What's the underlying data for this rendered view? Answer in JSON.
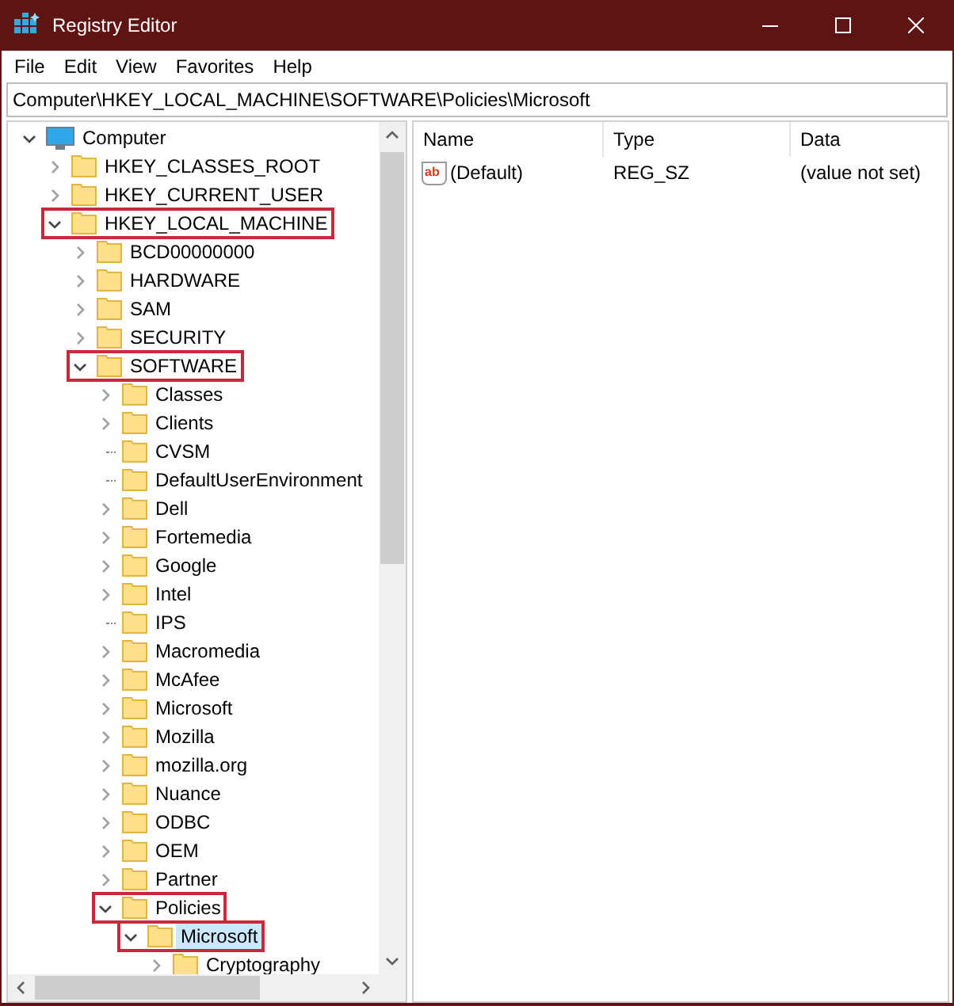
{
  "window": {
    "title": "Registry Editor"
  },
  "menu": [
    "File",
    "Edit",
    "View",
    "Favorites",
    "Help"
  ],
  "address": {
    "value": "Computer\\HKEY_LOCAL_MACHINE\\SOFTWARE\\Policies\\Microsoft"
  },
  "tree": [
    {
      "label": "Computer",
      "kind": "computer",
      "expanded": true,
      "selected": false,
      "highlighted": false,
      "children": [
        {
          "label": "HKEY_CLASSES_ROOT",
          "kind": "branch",
          "expanded": false,
          "selected": false,
          "highlighted": false
        },
        {
          "label": "HKEY_CURRENT_USER",
          "kind": "branch",
          "expanded": false,
          "selected": false,
          "highlighted": false
        },
        {
          "label": "HKEY_LOCAL_MACHINE",
          "kind": "branch",
          "expanded": true,
          "selected": false,
          "highlighted": true,
          "children": [
            {
              "label": "BCD00000000",
              "kind": "branch",
              "expanded": false,
              "selected": false,
              "highlighted": false
            },
            {
              "label": "HARDWARE",
              "kind": "branch",
              "expanded": false,
              "selected": false,
              "highlighted": false
            },
            {
              "label": "SAM",
              "kind": "branch",
              "expanded": false,
              "selected": false,
              "highlighted": false
            },
            {
              "label": "SECURITY",
              "kind": "branch",
              "expanded": false,
              "selected": false,
              "highlighted": false
            },
            {
              "label": "SOFTWARE",
              "kind": "branch",
              "expanded": true,
              "selected": false,
              "highlighted": true,
              "children": [
                {
                  "label": "Classes",
                  "kind": "branch",
                  "expanded": false,
                  "selected": false,
                  "highlighted": false
                },
                {
                  "label": "Clients",
                  "kind": "branch",
                  "expanded": false,
                  "selected": false,
                  "highlighted": false
                },
                {
                  "label": "CVSM",
                  "kind": "leaf",
                  "expanded": false,
                  "selected": false,
                  "highlighted": false
                },
                {
                  "label": "DefaultUserEnvironment",
                  "kind": "leaf",
                  "expanded": false,
                  "selected": false,
                  "highlighted": false
                },
                {
                  "label": "Dell",
                  "kind": "branch",
                  "expanded": false,
                  "selected": false,
                  "highlighted": false
                },
                {
                  "label": "Fortemedia",
                  "kind": "branch",
                  "expanded": false,
                  "selected": false,
                  "highlighted": false
                },
                {
                  "label": "Google",
                  "kind": "branch",
                  "expanded": false,
                  "selected": false,
                  "highlighted": false
                },
                {
                  "label": "Intel",
                  "kind": "branch",
                  "expanded": false,
                  "selected": false,
                  "highlighted": false
                },
                {
                  "label": "IPS",
                  "kind": "leaf",
                  "expanded": false,
                  "selected": false,
                  "highlighted": false
                },
                {
                  "label": "Macromedia",
                  "kind": "branch",
                  "expanded": false,
                  "selected": false,
                  "highlighted": false
                },
                {
                  "label": "McAfee",
                  "kind": "branch",
                  "expanded": false,
                  "selected": false,
                  "highlighted": false
                },
                {
                  "label": "Microsoft",
                  "kind": "branch",
                  "expanded": false,
                  "selected": false,
                  "highlighted": false
                },
                {
                  "label": "Mozilla",
                  "kind": "branch",
                  "expanded": false,
                  "selected": false,
                  "highlighted": false
                },
                {
                  "label": "mozilla.org",
                  "kind": "branch",
                  "expanded": false,
                  "selected": false,
                  "highlighted": false
                },
                {
                  "label": "Nuance",
                  "kind": "branch",
                  "expanded": false,
                  "selected": false,
                  "highlighted": false
                },
                {
                  "label": "ODBC",
                  "kind": "branch",
                  "expanded": false,
                  "selected": false,
                  "highlighted": false
                },
                {
                  "label": "OEM",
                  "kind": "branch",
                  "expanded": false,
                  "selected": false,
                  "highlighted": false
                },
                {
                  "label": "Partner",
                  "kind": "branch",
                  "expanded": false,
                  "selected": false,
                  "highlighted": false
                },
                {
                  "label": "Policies",
                  "kind": "branch",
                  "expanded": true,
                  "selected": false,
                  "highlighted": true,
                  "children": [
                    {
                      "label": "Microsoft",
                      "kind": "branch",
                      "expanded": true,
                      "selected": true,
                      "highlighted": true,
                      "children": [
                        {
                          "label": "Cryptography",
                          "kind": "branch",
                          "expanded": false,
                          "selected": false,
                          "highlighted": false
                        }
                      ]
                    }
                  ]
                }
              ]
            }
          ]
        }
      ]
    }
  ],
  "list": {
    "columns": [
      "Name",
      "Type",
      "Data"
    ],
    "rows": [
      {
        "icon": "ab",
        "name": "(Default)",
        "type": "REG_SZ",
        "data": "(value not set)"
      }
    ]
  }
}
